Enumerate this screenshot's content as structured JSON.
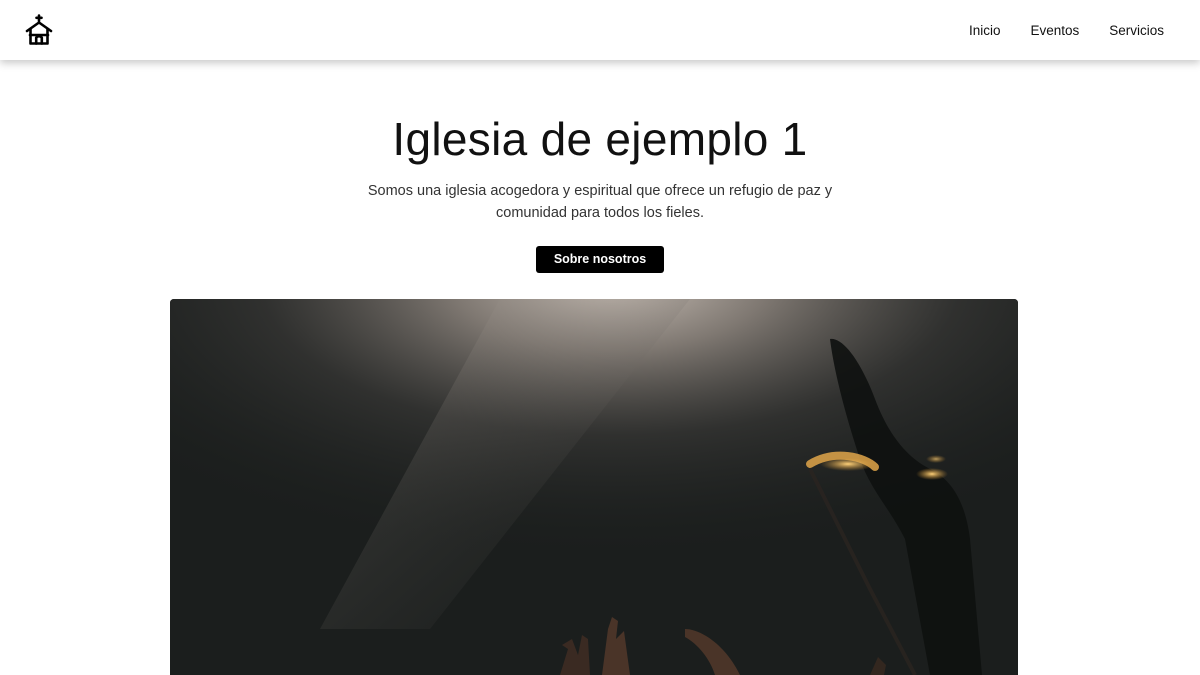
{
  "nav": {
    "logo_icon": "church-icon",
    "links": [
      {
        "label": "Inicio"
      },
      {
        "label": "Eventos"
      },
      {
        "label": "Servicios"
      }
    ]
  },
  "hero": {
    "title": "Iglesia de ejemplo 1",
    "description": "Somos una iglesia acogedora y espiritual que ofrece un refugio de paz y comunidad para todos los fieles.",
    "button_label": "Sobre nosotros",
    "image_subject": "worship-hands-spotlight-photo"
  },
  "colors": {
    "button_bg": "#000000",
    "button_text": "#ffffff",
    "page_bg": "#ffffff",
    "image_bg": "#1b1e1d"
  }
}
